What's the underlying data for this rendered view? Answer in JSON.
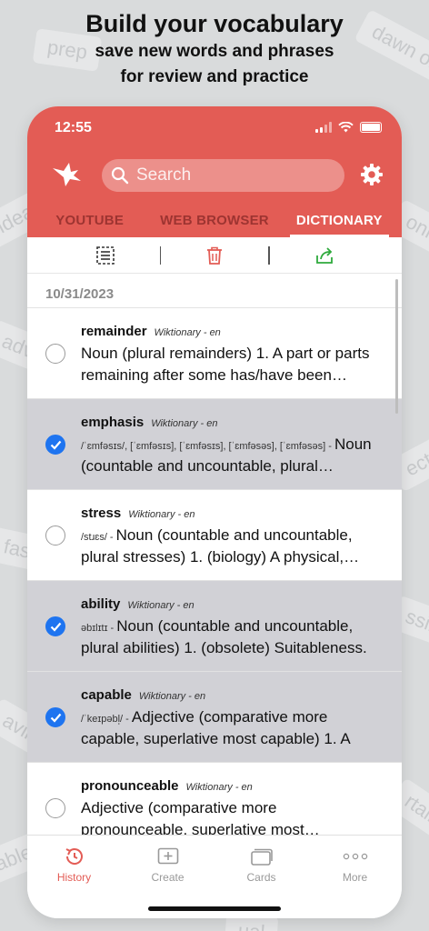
{
  "promo": {
    "title": "Build your vocabulary",
    "subtitle_line1": "save new words and phrases",
    "subtitle_line2": "for review and practice"
  },
  "background_words": [
    "prep",
    "dawn on",
    "idea",
    "adv",
    "fas",
    "avin",
    "able",
    "ect",
    "ssib",
    "rtain",
    "onn",
    "ual"
  ],
  "status_bar": {
    "time": "12:55"
  },
  "app": {
    "brand_color": "#e35c55",
    "selected_color": "#1e74f0"
  },
  "search": {
    "placeholder": "Search"
  },
  "tabs": [
    {
      "label": "YOUTUBE",
      "active": false
    },
    {
      "label": "WEB BROWSER",
      "active": false
    },
    {
      "label": "DICTIONARY",
      "active": true
    }
  ],
  "toolbar": {
    "icons": [
      "select-all-icon",
      "delete-icon",
      "share-icon"
    ]
  },
  "date_header": "10/31/2023",
  "entries": [
    {
      "word": "remainder",
      "source": "Wiktionary - en",
      "pron": "",
      "definition": "Noun (plural remainders) 1. A part or parts remaining after some has/have been removed.",
      "selected": false
    },
    {
      "word": "emphasis",
      "source": "Wiktionary - en",
      "pron": "/ˈɛmfəsɪs/, [ˈɛmfəsɪs], [ˈɛmfəsɪs], [ˈɛmfəsəs], [ˈɛmfəsəs] - ",
      "definition": "Noun (countable and uncountable, plural emphases)",
      "selected": true
    },
    {
      "word": "stress",
      "source": "Wiktionary - en",
      "pron": "/stɹɛs/ - ",
      "definition": "Noun (countable and uncountable, plural stresses) 1. (biology) A physical, chemical, or emotional factor",
      "selected": false
    },
    {
      "word": "ability",
      "source": "Wiktionary - en",
      "pron": "əbɪlɪtɪ - ",
      "definition": "Noun (countable and uncountable, plural abilities) 1. (obsolete) Suitableness.",
      "selected": true
    },
    {
      "word": "capable",
      "source": "Wiktionary - en",
      "pron": "/ˈkeɪpəbl̩/ - ",
      "definition": "Adjective (comparative more capable, superlative most capable) 1. A",
      "selected": true
    },
    {
      "word": "pronounceable",
      "source": "Wiktionary - en",
      "pron": "",
      "definition": "Adjective (comparative more pronounceable, superlative most pronounceable)",
      "selected": false
    }
  ],
  "bottom_tabs": [
    {
      "label": "History",
      "icon": "history-icon",
      "active": true
    },
    {
      "label": "Create",
      "icon": "create-icon",
      "active": false
    },
    {
      "label": "Cards",
      "icon": "cards-icon",
      "active": false
    },
    {
      "label": "More",
      "icon": "more-icon",
      "active": false
    }
  ]
}
